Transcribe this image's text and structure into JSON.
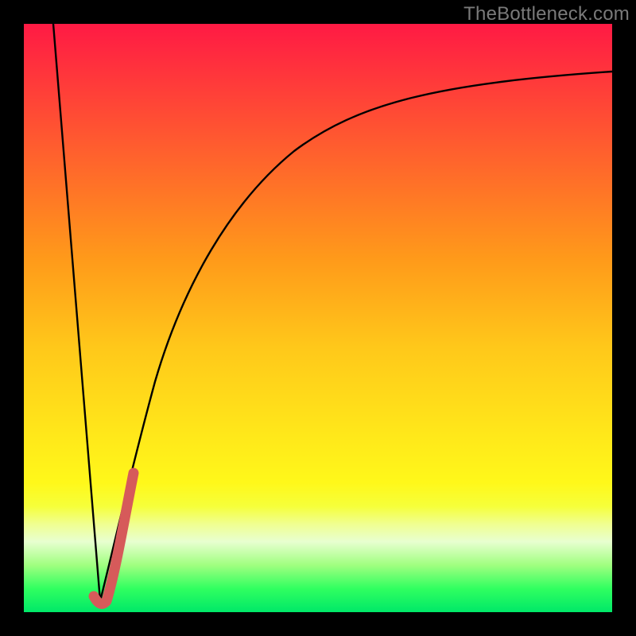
{
  "watermark": "TheBottleneck.com",
  "colors": {
    "curve_black": "#000000",
    "accent_pink": "#d65a5a",
    "frame_black": "#000000"
  },
  "chart_data": {
    "type": "line",
    "title": "",
    "xlabel": "",
    "ylabel": "",
    "xlim": [
      0,
      100
    ],
    "ylim": [
      0,
      100
    ],
    "grid": false,
    "series": [
      {
        "name": "left-descent",
        "values": [
          {
            "x": 5,
            "y": 100
          },
          {
            "x": 13,
            "y": 2
          }
        ]
      },
      {
        "name": "right-asymptote",
        "values": [
          {
            "x": 13,
            "y": 2
          },
          {
            "x": 15,
            "y": 10
          },
          {
            "x": 18,
            "y": 24
          },
          {
            "x": 22,
            "y": 40
          },
          {
            "x": 28,
            "y": 55
          },
          {
            "x": 36,
            "y": 68
          },
          {
            "x": 46,
            "y": 78
          },
          {
            "x": 58,
            "y": 84
          },
          {
            "x": 72,
            "y": 88
          },
          {
            "x": 100,
            "y": 92
          }
        ]
      },
      {
        "name": "pink-accent-segment",
        "values": [
          {
            "x": 12,
            "y": 3
          },
          {
            "x": 13,
            "y": 2
          },
          {
            "x": 14.5,
            "y": 4
          },
          {
            "x": 18,
            "y": 24
          }
        ]
      }
    ]
  }
}
